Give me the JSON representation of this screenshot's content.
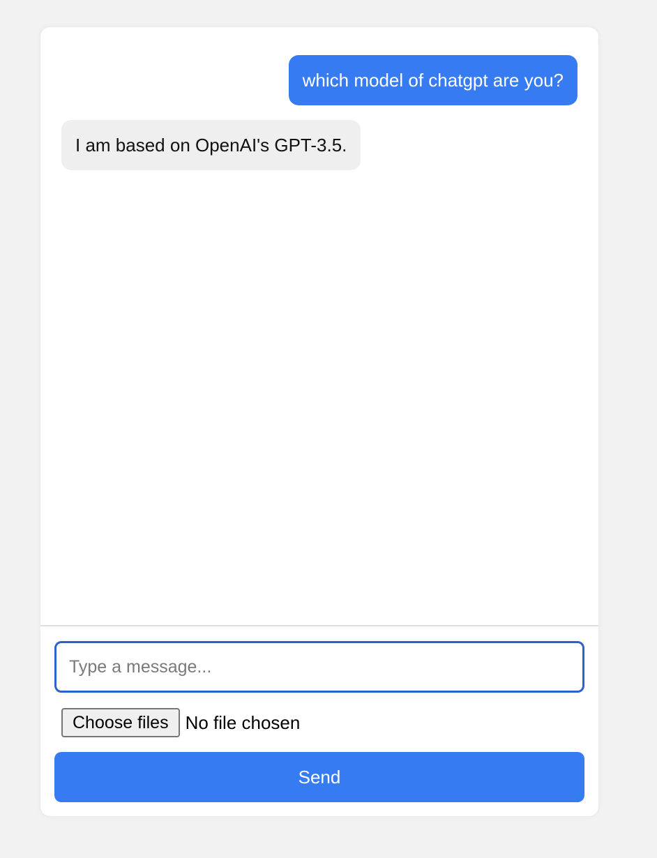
{
  "messages": [
    {
      "role": "user",
      "text": "which model of chatgpt are you?"
    },
    {
      "role": "bot",
      "text": "I am based on OpenAI's GPT-3.5."
    }
  ],
  "composer": {
    "placeholder": "Type a message...",
    "value": "",
    "file_button_label": "Choose files",
    "file_status": "No file chosen",
    "send_label": "Send"
  },
  "colors": {
    "accent": "#377bf3",
    "bot_bubble": "#efefef",
    "focus_border": "#2d62c8",
    "page_background": "#f2f2f2"
  }
}
